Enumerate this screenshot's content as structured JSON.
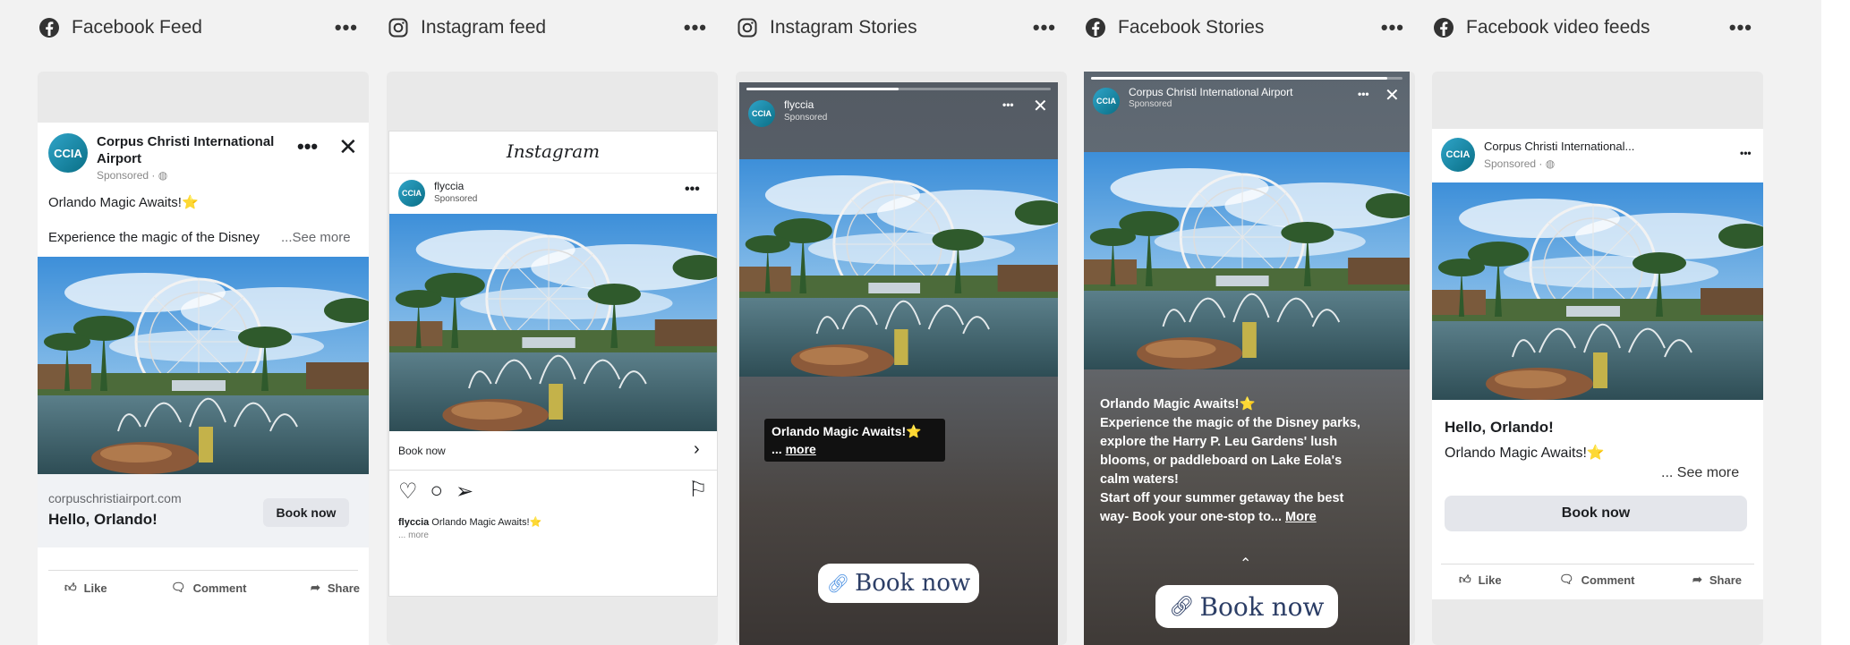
{
  "columns": [
    {
      "title": "Facebook Feed",
      "icon": "facebook-icon"
    },
    {
      "title": "Instagram feed",
      "icon": "instagram-icon"
    },
    {
      "title": "Instagram Stories",
      "icon": "instagram-icon"
    },
    {
      "title": "Facebook Stories",
      "icon": "facebook-icon"
    },
    {
      "title": "Facebook video feeds",
      "icon": "facebook-icon"
    }
  ],
  "more_glyph": "•••",
  "brand": {
    "name": "Corpus Christi International Airport",
    "name_short": "Corpus Christi International...",
    "handle": "flyccia",
    "logo_text": "CCIA",
    "accent": "#1877f2"
  },
  "fb_feed": {
    "sponsored": "Sponsored · ",
    "headline": "Orlando Magic Awaits!⭐",
    "body": "Experience the magic of the Disney",
    "see_more": "...See more",
    "domain": "corpuschristiairport.com",
    "title": "Hello, Orlando!",
    "cta": "Book now",
    "actions": [
      "Like",
      "Comment",
      "Share"
    ]
  },
  "ig_feed": {
    "app_name": "Instagram",
    "sponsored": "Sponsored",
    "cta": "Book now",
    "caption_user": "flyccia",
    "caption": " Orlando Magic Awaits!⭐",
    "more": "... more"
  },
  "ig_stories": {
    "sponsored": "Sponsored",
    "caption_line1": "Orlando Magic Awaits!⭐",
    "caption_line2_prefix": "... ",
    "caption_more": "more",
    "cta": "Book now",
    "progress": 0.5
  },
  "fb_stories": {
    "sponsored": "Sponsored",
    "headline": "Orlando Magic Awaits!⭐",
    "body_lines": [
      "Experience the magic of the Disney parks,",
      "explore the Harry P. Leu Gardens' lush",
      "blooms, or paddleboard on Lake Eola's",
      "calm waters!",
      "Start off your summer getaway the best"
    ],
    "last_line": "way- Book your one-stop to... ",
    "more": "More",
    "cta": "Book now",
    "progress": 0.95
  },
  "fb_video": {
    "sponsored": "Sponsored · ",
    "title": "Hello, Orlando!",
    "headline": "Orlando Magic Awaits!⭐",
    "see_more": "... See more",
    "cta": "Book now",
    "actions": [
      "Like",
      "Comment",
      "Share"
    ]
  }
}
